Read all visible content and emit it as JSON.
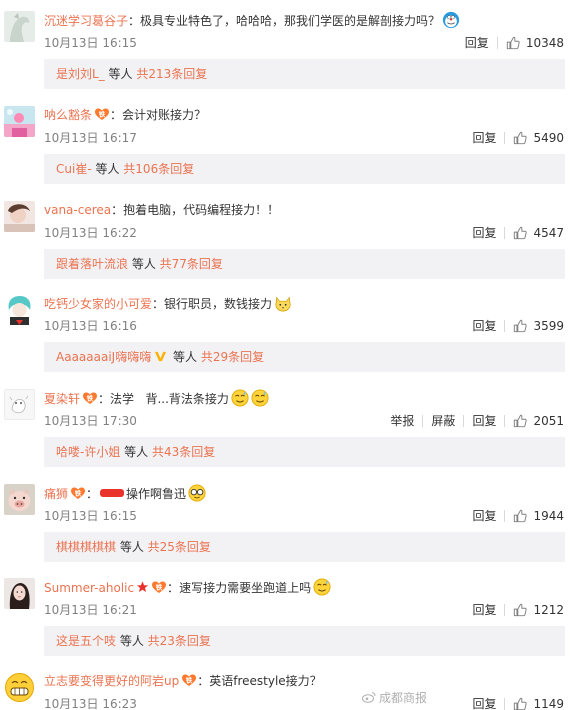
{
  "comments": [
    {
      "username": "沉迷学习葛谷子",
      "separator": "：",
      "text": "极具专业特色了，哈哈哈，那我们学医的是解剖接力吗？",
      "emoji_icons": [
        "doraemon-emoji-icon"
      ],
      "timestamp": "10月13日 16:15",
      "reply_label": "回复",
      "likes": "10348",
      "thread": {
        "user": "是刘刘L_",
        "mid": " 等人 ",
        "more": "共213条回复"
      }
    },
    {
      "username": "呐么豁条",
      "separator": "：",
      "text": "会计对账接力？",
      "has_fan_badge": true,
      "timestamp": "10月13日 16:17",
      "reply_label": "回复",
      "likes": "5490",
      "thread": {
        "user": "Cui崔-",
        "mid": " 等人 ",
        "more": "共106条回复"
      }
    },
    {
      "username": "vana-cerea",
      "separator": "：",
      "text": "抱着电脑，代码编程接力！！",
      "timestamp": "10月13日 16:22",
      "reply_label": "回复",
      "likes": "4547",
      "thread": {
        "user": "跟着落叶流浪",
        "mid": " 等人 ",
        "more": "共77条回复"
      }
    },
    {
      "username": "吃钙少女家的小可爱",
      "separator": "：",
      "text": "银行职员，数钱接力",
      "emoji_icons": [
        "cat-emoji-icon"
      ],
      "timestamp": "10月13日 16:16",
      "reply_label": "回复",
      "likes": "3599",
      "thread": {
        "user": "AaaaaaaiJ嗨嗨嗨",
        "has_vip": true,
        "mid": " 等人 ",
        "more": "共29条回复"
      }
    },
    {
      "username": "夏染轩",
      "separator": "：",
      "text": "法学   背...背法条接力",
      "has_fan_badge": true,
      "emoji_icons": [
        "sweat-emoji-icon",
        "sweat-emoji-icon"
      ],
      "timestamp": "10月13日 17:30",
      "report_label": "举报",
      "block_label": "屏蔽",
      "reply_label": "回复",
      "likes": "2051",
      "thread": {
        "user": "哈喽-许小姐",
        "mid": " 等人 ",
        "more": "共43条回复"
      }
    },
    {
      "username": "痛狮",
      "separator": "：",
      "redacted": true,
      "text": "操作啊鲁迅",
      "has_fan_badge": true,
      "emoji_icons": [
        "nerd-emoji-icon"
      ],
      "timestamp": "10月13日 16:15",
      "reply_label": "回复",
      "likes": "1944",
      "thread": {
        "user": "棋棋棋棋棋",
        "mid": " 等人 ",
        "more": "共25条回复"
      }
    },
    {
      "username": "Summer-aholic",
      "separator": "：",
      "text": "速写接力需要坐跑道上吗",
      "has_star": true,
      "has_fan_badge": true,
      "emoji_icons": [
        "sweat-emoji-icon"
      ],
      "timestamp": "10月13日 16:21",
      "reply_label": "回复",
      "likes": "1212",
      "thread": {
        "user": "这是五个吱",
        "mid": " 等人 ",
        "more": "共23条回复"
      }
    },
    {
      "username": "立志要变得更好的阿岩up",
      "separator": "：",
      "text": "英语freestyle接力？",
      "has_fan_badge": true,
      "timestamp": "10月13日 16:23",
      "reply_label": "回复",
      "likes": "1149"
    }
  ],
  "watermark": {
    "text": "成都商报",
    "icon": "weibo-icon"
  },
  "colors": {
    "username": "#eb7350",
    "reply_bg": "#f2f2f5",
    "meta": "#808080"
  }
}
